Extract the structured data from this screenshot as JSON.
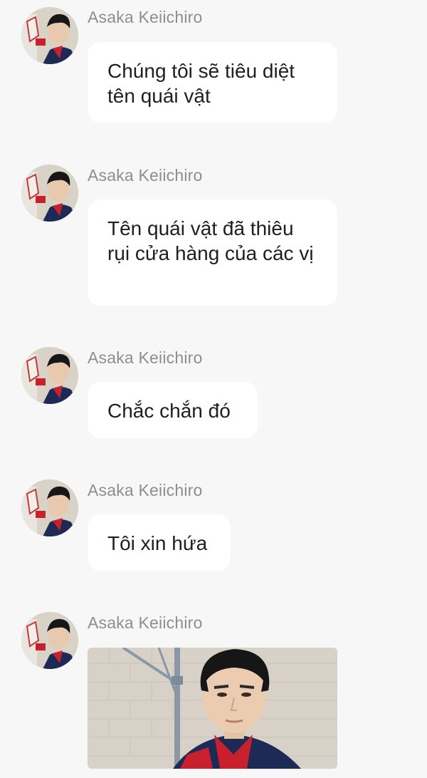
{
  "messages": [
    {
      "sender": "Asaka Keiichiro",
      "text": "Chúng tôi sẽ tiêu diệt tên quái vật"
    },
    {
      "sender": "Asaka Keiichiro",
      "text": "Tên quái vật đã thiêu rụi cửa hàng của các vị"
    },
    {
      "sender": "Asaka Keiichiro",
      "text": "Chắc chắn đó"
    },
    {
      "sender": "Asaka Keiichiro",
      "text": "Tôi xin hứa"
    },
    {
      "sender": "Asaka Keiichiro",
      "image": "photo-of-sender"
    }
  ],
  "colors": {
    "background": "#f7f7f7",
    "bubble": "#ffffff",
    "sender_name": "#8e8e8e",
    "text": "#1f1f1f",
    "uniform_red": "#c8202c",
    "uniform_navy": "#1d2a55"
  }
}
